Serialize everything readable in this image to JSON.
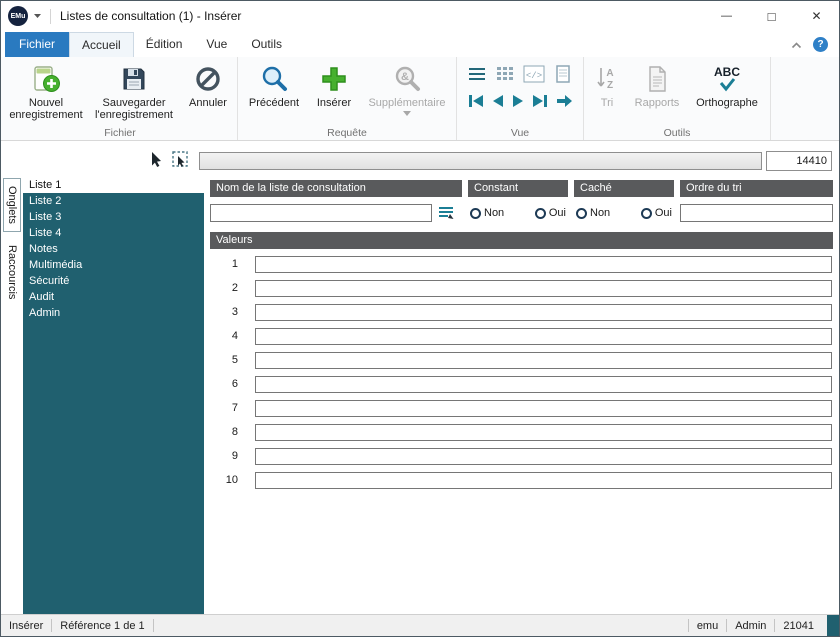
{
  "window": {
    "logo": "EMu",
    "title": "Listes de consultation (1) - Insérer",
    "controls": {
      "minimize": "—",
      "maximize": "□",
      "close": "✕"
    }
  },
  "tabs": {
    "file": "Fichier",
    "items": [
      "Accueil",
      "Édition",
      "Vue",
      "Outils"
    ],
    "help": "?"
  },
  "ribbon": {
    "groups": {
      "fichier": "Fichier",
      "requete": "Requête",
      "vue": "Vue",
      "outils": "Outils"
    },
    "buttons": {
      "new_record": "Nouvel enregistrement",
      "save_record": "Sauvegarder l'enregistrement",
      "cancel": "Annuler",
      "previous": "Précédent",
      "insert": "Insérer",
      "additional": "Supplémentaire",
      "sort": "Tri",
      "reports": "Rapports",
      "spelling": "Orthographe"
    }
  },
  "toolrow": {
    "record_count": "14410"
  },
  "side_tabs": {
    "onglets": "Onglets",
    "raccourcis": "Raccourcis"
  },
  "sidebar": {
    "items": [
      "Liste 1",
      "Liste 2",
      "Liste 3",
      "Liste 4",
      "Notes",
      "Multimédia",
      "Sécurité",
      "Audit",
      "Admin"
    ],
    "selected": "Liste 1"
  },
  "form": {
    "name_header": "Nom de la liste de consultation",
    "name_value": "",
    "constant_header": "Constant",
    "hidden_header": "Caché",
    "option_no": "Non",
    "option_yes": "Oui",
    "sort_header": "Ordre du tri",
    "sort_value": "",
    "values_header": "Valeurs",
    "row_numbers": [
      "1",
      "2",
      "3",
      "4",
      "5",
      "6",
      "7",
      "8",
      "9",
      "10"
    ],
    "row_values": [
      "",
      "",
      "",
      "",
      "",
      "",
      "",
      "",
      "",
      ""
    ]
  },
  "statusbar": {
    "mode": "Insérer",
    "reference": "Référence 1 de 1",
    "server": "emu",
    "user": "Admin",
    "session": "21041"
  },
  "colors": {
    "accent_teal": "#1b7e95",
    "sidebar_teal": "#20606f",
    "header_gray": "#595a5c",
    "file_tab_blue": "#2a7ac0",
    "insert_green": "#46b02e"
  }
}
